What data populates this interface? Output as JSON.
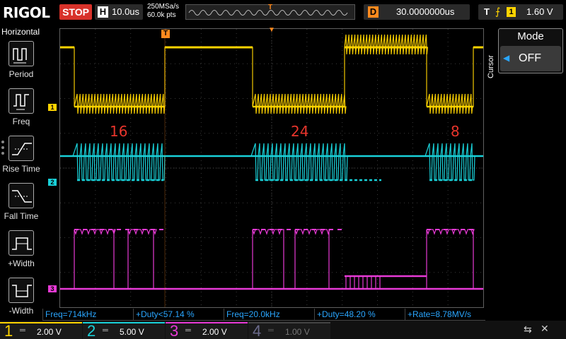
{
  "header": {
    "logo": "RIGOL",
    "run_state": "STOP",
    "timebase": {
      "label": "H",
      "value": "10.0us"
    },
    "sample_rate": "250MSa/s",
    "memory_depth": "60.0k pts",
    "delay": {
      "label": "D",
      "value": "30.0000000us"
    },
    "trigger": {
      "label": "T",
      "source": "1",
      "level": "1.60 V"
    }
  },
  "left_panel": {
    "title": "Horizontal",
    "items": [
      {
        "label": "Period",
        "icon": "period-icon"
      },
      {
        "label": "Freq",
        "icon": "freq-icon"
      },
      {
        "label": "Rise Time",
        "icon": "rise-time-icon"
      },
      {
        "label": "Fall Time",
        "icon": "fall-time-icon"
      },
      {
        "label": "+Width",
        "icon": "positive-width-icon"
      },
      {
        "label": "-Width",
        "icon": "negative-width-icon"
      }
    ]
  },
  "right_panel": {
    "section": "Cursor",
    "title": "Mode",
    "value": "OFF"
  },
  "annotations": [
    "16",
    "24",
    "8"
  ],
  "channel_markers": [
    "1",
    "2",
    "3"
  ],
  "measurements": [
    {
      "text": "Freq=714kHz"
    },
    {
      "text": "+Duty<57.14 %"
    },
    {
      "text": "Freq=20.0kHz"
    },
    {
      "text": "+Duty=48.20 %"
    },
    {
      "text": "+Rate=8.78MV/s"
    }
  ],
  "channels": [
    {
      "num": "1",
      "scale": "2.00 V",
      "color": "#ffd400",
      "active": true
    },
    {
      "num": "2",
      "scale": "5.00 V",
      "color": "#19d1d9",
      "active": true
    },
    {
      "num": "3",
      "scale": "2.00 V",
      "color": "#e83ad6",
      "active": true
    },
    {
      "num": "4",
      "scale": "1.00 V",
      "color": "#6a6a8a",
      "active": false
    }
  ],
  "colors": {
    "ch1": "#ffd400",
    "ch2": "#19d1d9",
    "ch3": "#e83ad6",
    "accent": "#ff8a1e",
    "measure": "#2aa6ff"
  }
}
